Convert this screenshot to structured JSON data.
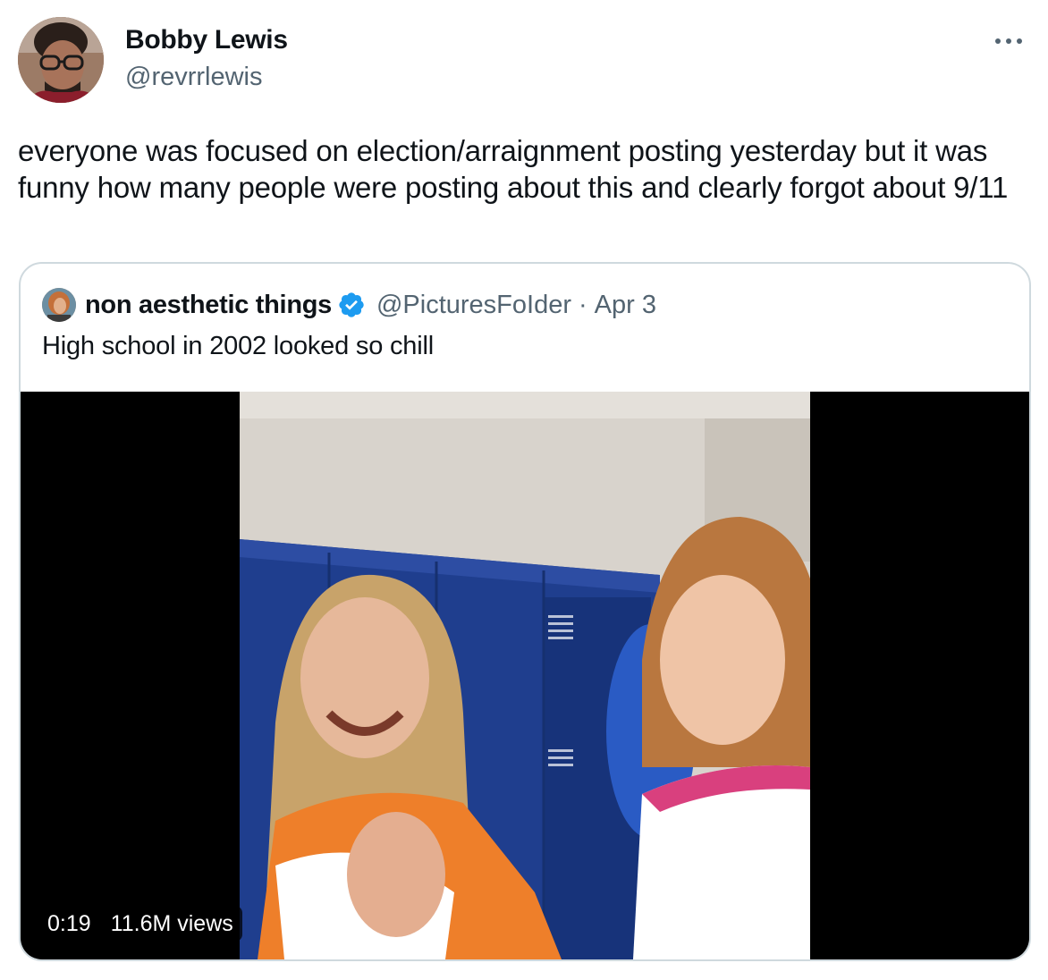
{
  "tweet": {
    "author": {
      "name": "Bobby Lewis",
      "handle": "@revrrlewis"
    },
    "more_icon": "ellipsis-icon",
    "text": "everyone was focused on election/arraignment posting yesterday but it was funny how many people were posting about this and clearly forgot about 9/11"
  },
  "quoted_tweet": {
    "author": {
      "name": "non aesthetic things",
      "handle": "@PicturesFoIder",
      "verified": true
    },
    "separator": "·",
    "date": "Apr 3",
    "text": "High school in 2002 looked so chill",
    "video": {
      "duration": "0:19",
      "views": "11.6M views"
    }
  },
  "colors": {
    "text_primary": "#0f1419",
    "text_secondary": "#536471",
    "border": "#cfd9de",
    "verified_blue": "#1d9bf0"
  }
}
